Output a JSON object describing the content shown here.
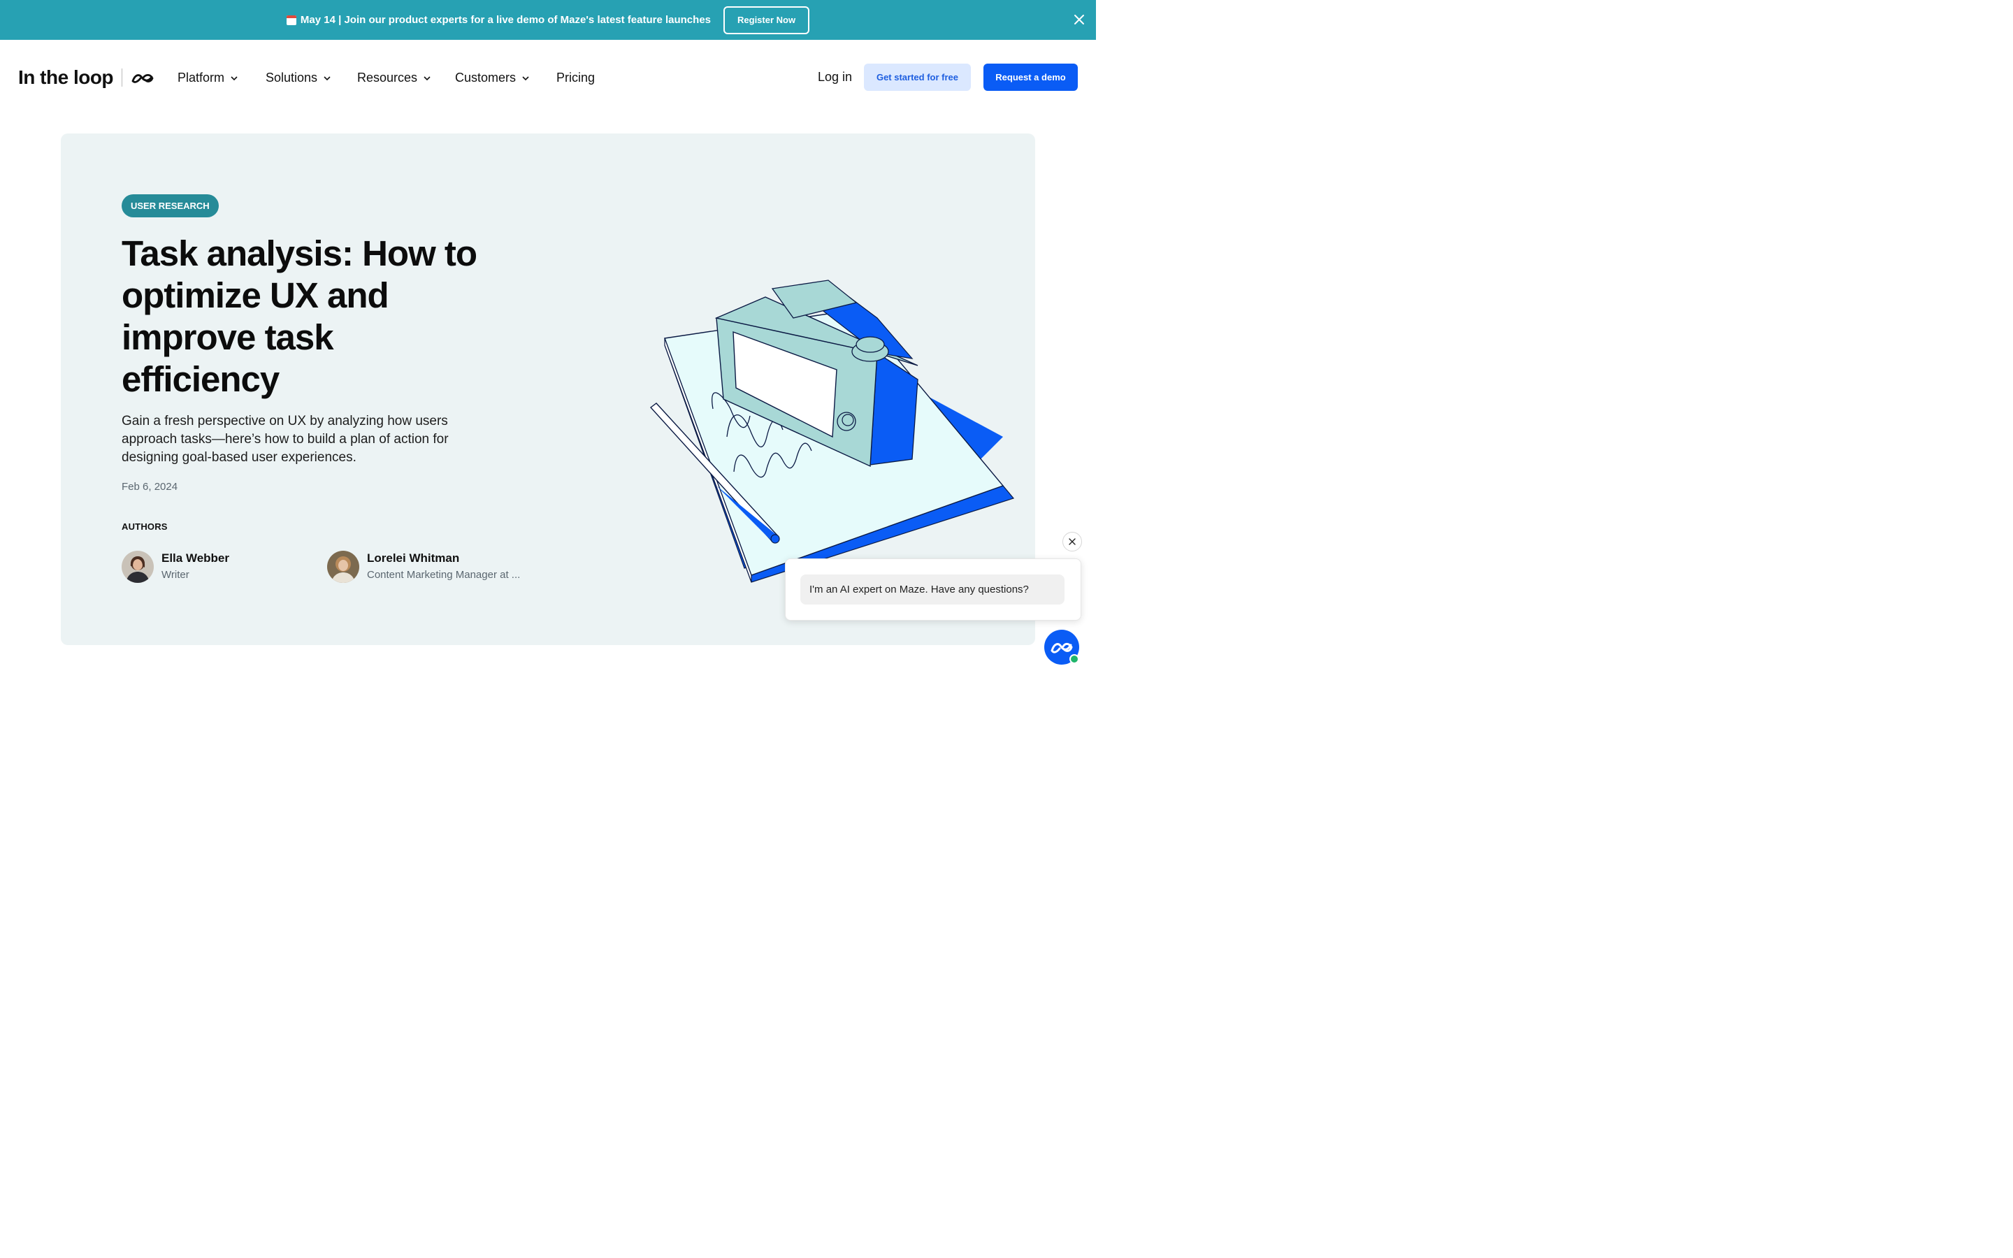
{
  "banner": {
    "icon": "calendar-icon",
    "text": "May 14 | Join our product experts for a live demo of Maze's latest feature launches",
    "button_label": "Register Now",
    "background": "#27a1b3"
  },
  "header": {
    "logo_text": "In the loop",
    "nav": [
      {
        "label": "Platform"
      },
      {
        "label": "Solutions"
      },
      {
        "label": "Resources"
      },
      {
        "label": "Customers"
      },
      {
        "label": "Pricing"
      }
    ],
    "login_label": "Log in",
    "cta_secondary": "Get started for free",
    "cta_primary": "Request a demo",
    "accent": "#0a5cf5"
  },
  "article": {
    "category": "USER RESEARCH",
    "title": "Task analysis: How to optimize UX and improve task efficiency",
    "lede": "Gain a fresh perspective on UX by analyzing how users approach tasks—here’s how to build a plan of action for designing goal-based user experiences.",
    "date": "Feb 6, 2024",
    "authors_label": "AUTHORS",
    "authors": [
      {
        "name": "Ella Webber",
        "role": "Writer"
      },
      {
        "name": "Lorelei Whitman",
        "role": "Content Marketing Manager at ..."
      }
    ]
  },
  "chat": {
    "message": "I'm an AI expert on Maze. Have any questions?"
  }
}
